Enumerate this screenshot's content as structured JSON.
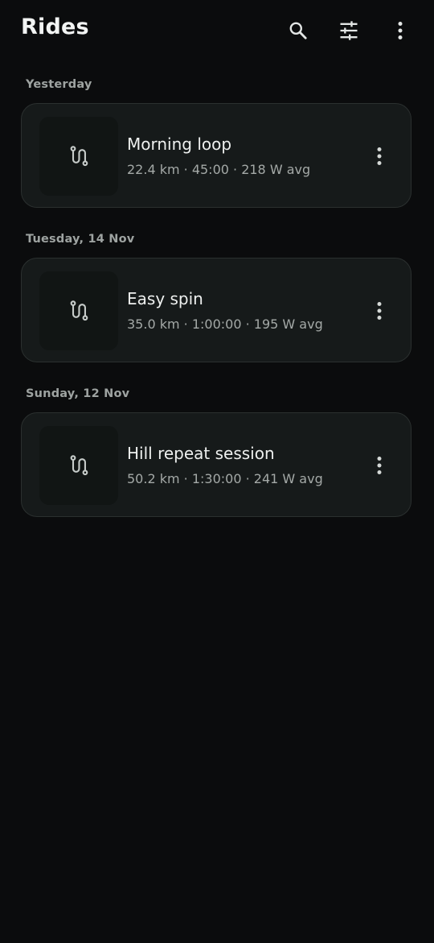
{
  "app_bar": {
    "title": "Rides",
    "actions": [
      {
        "icon": "search-icon"
      },
      {
        "icon": "tune-icon"
      },
      {
        "icon": "more-vert-icon"
      }
    ]
  },
  "colors": {
    "background": "#0b0c0d",
    "card": "#161a1a",
    "card_border": "#2b302f",
    "text_primary": "#eef0ef",
    "text_secondary": "#a4a9a7",
    "header_text": "#9ea3a1"
  },
  "sections": [
    {
      "header": "Yesterday",
      "rides": [
        {
          "title": "Morning loop",
          "meta": "22.4 km · 45:00 · 218 W avg",
          "icon": "route-icon"
        }
      ]
    },
    {
      "header": "Tuesday, 14 Nov",
      "rides": [
        {
          "title": "Easy spin",
          "meta": "35.0 km · 1:00:00 · 195 W avg",
          "icon": "route-icon"
        }
      ]
    },
    {
      "header": "Sunday, 12 Nov",
      "rides": [
        {
          "title": "Hill repeat session",
          "meta": "50.2 km · 1:30:00 · 241 W avg",
          "icon": "route-icon"
        }
      ]
    }
  ]
}
